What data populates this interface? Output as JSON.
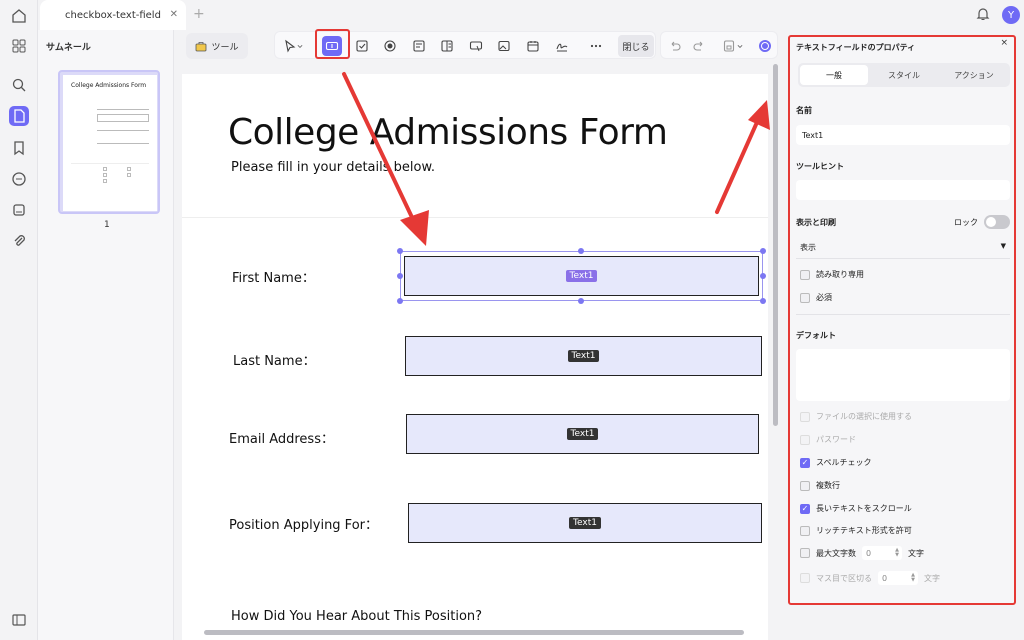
{
  "tab": {
    "title": "checkbox-text-field"
  },
  "user": {
    "avatar_initial": "Y"
  },
  "thumbnails": {
    "title": "サムネール",
    "page_number": "1",
    "preview_title": "College Admissions Form"
  },
  "toolbar": {
    "tools_label": "ツール",
    "close_label": "閉じる"
  },
  "document": {
    "title": "College Admissions Form",
    "subtitle": "Please fill in your details below.",
    "fields": [
      {
        "label": "First Name：",
        "tag": "Text1"
      },
      {
        "label": "Last Name：",
        "tag": "Text1"
      },
      {
        "label": "Email Address：",
        "tag": "Text1"
      },
      {
        "label": "Position Applying For：",
        "tag": "Text1"
      }
    ],
    "question": "How Did You Hear About This Position?"
  },
  "properties": {
    "title": "テキストフィールドのプロパティ",
    "close": "×",
    "tabs": [
      "一般",
      "スタイル",
      "アクション"
    ],
    "name_label": "名前",
    "name_value": "Text1",
    "tooltip_label": "ツールヒント",
    "tooltip_value": "",
    "display_print_label": "表示と印刷",
    "lock_label": "ロック",
    "visibility_value": "表示",
    "readonly_label": "読み取り専用",
    "required_label": "必須",
    "default_label": "デフォルト",
    "file_select_label": "ファイルの選択に使用する",
    "password_label": "パスワード",
    "spellcheck_label": "スペルチェック",
    "multiline_label": "複数行",
    "scroll_label": "長いテキストをスクロール",
    "richtext_label": "リッチテキスト形式を許可",
    "maxchars_label": "最大文字数",
    "maxchars_value": "0",
    "maxchars_unit": "文字",
    "comb_label": "マス目で区切る",
    "comb_value": "0",
    "comb_unit": "文字"
  },
  "colors": {
    "accent": "#6f6af5",
    "highlight_red": "#e53935",
    "field_fill": "#e6e8fb"
  }
}
